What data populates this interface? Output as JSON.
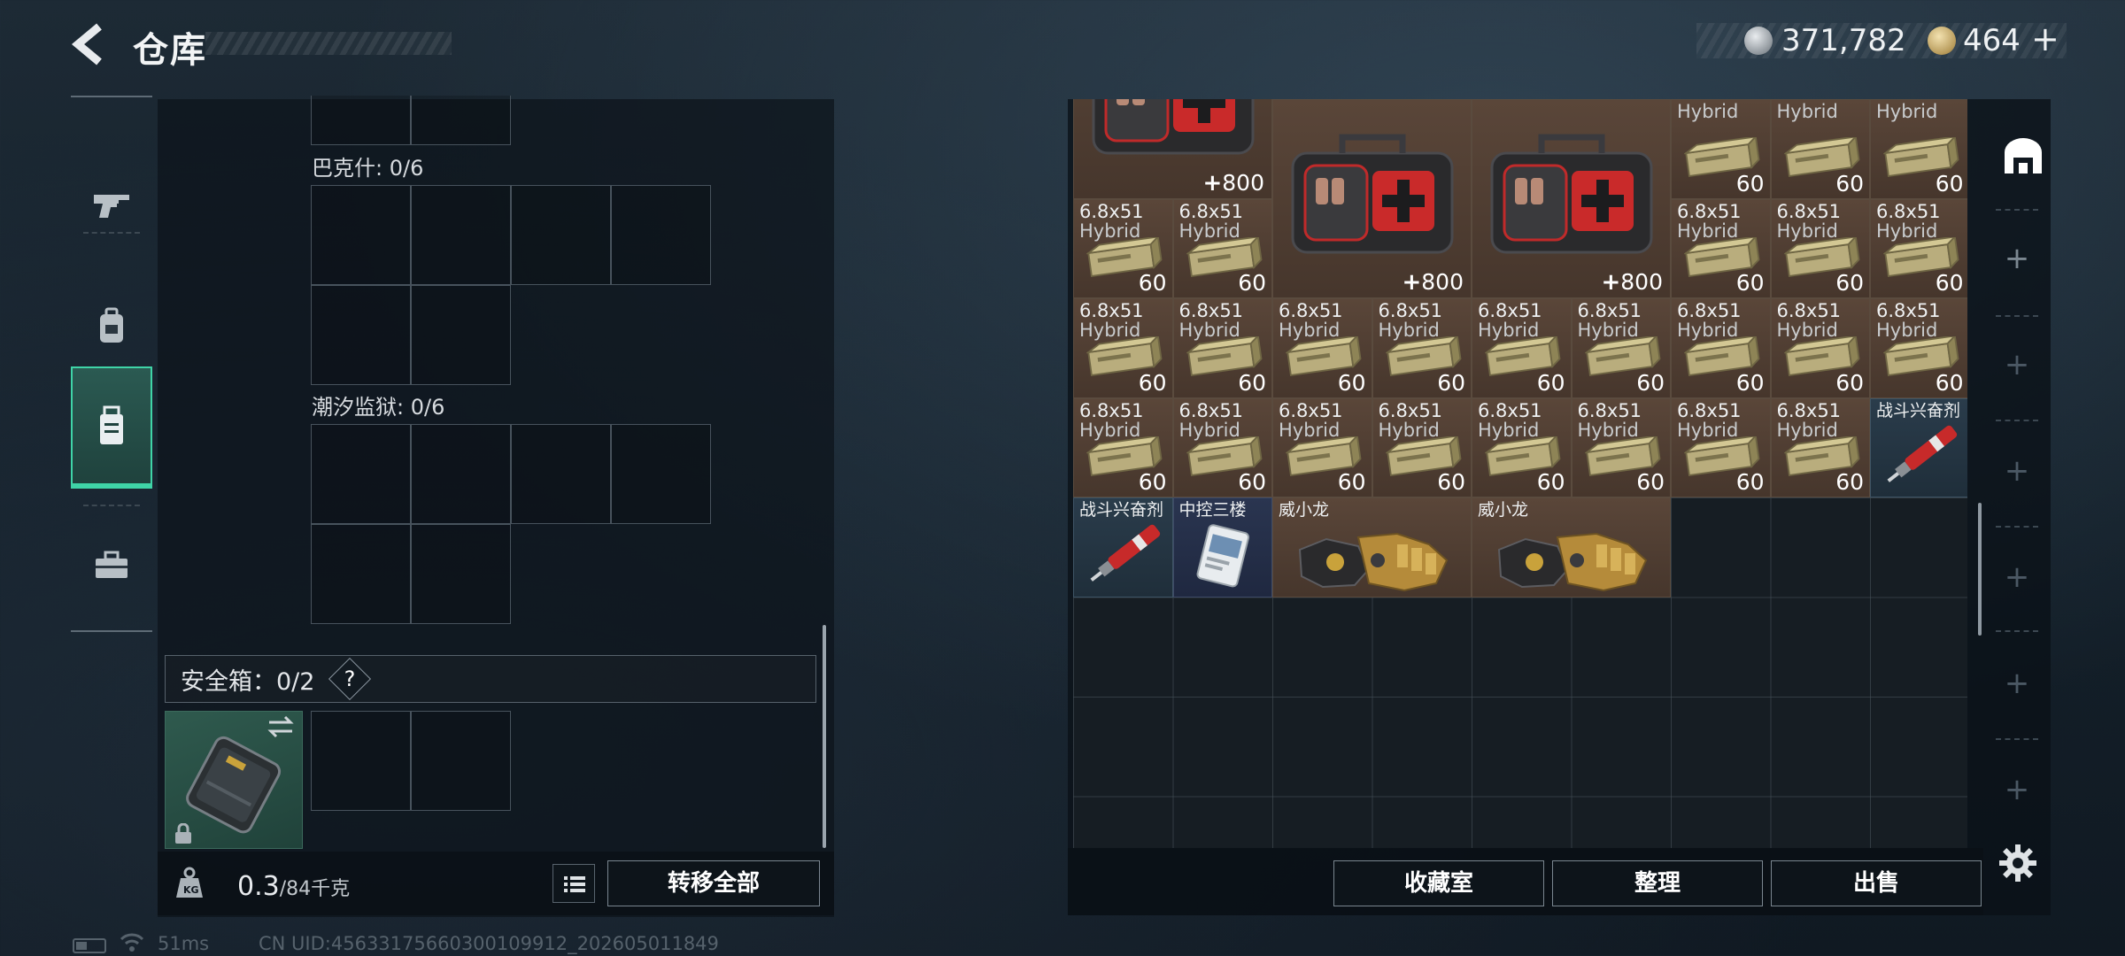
{
  "header": {
    "title": "仓库"
  },
  "currency": {
    "silver": "371,782",
    "gold": "464",
    "gold_plus": "+"
  },
  "left_nav": {
    "items": [
      "gun-icon",
      "backpack-icon",
      "vest-icon",
      "toolbox-icon"
    ],
    "active_index": 2
  },
  "left_panel": {
    "grids": [
      {
        "label": "巴克什: 0/6"
      },
      {
        "label": "潮汐监狱: 0/6"
      }
    ],
    "safe_box": {
      "label": "安全箱：0/2",
      "help": "?"
    },
    "weight": {
      "current": "0.3",
      "max": "/84千克"
    },
    "transfer_label": "转移全部"
  },
  "stash": {
    "ammo_name": "6.8x51",
    "ammo_sub": "Hybrid",
    "ammo_count": "60",
    "medkit_count": "800",
    "medkit_plus": "+",
    "stim_name": "战斗兴奋剂",
    "keycard_name": "中控三楼",
    "gauntlet_name": "威小龙"
  },
  "bottom_actions": {
    "collection": "收藏室",
    "organize": "整理",
    "sell": "出售"
  },
  "status": {
    "ping": "51ms",
    "uid": "CN UID:4563317566030010991​2_202605011849"
  },
  "colors": {
    "accent": "#3fd4a7",
    "cell_brown": "#4f3d31",
    "cell_blue": "#233441"
  }
}
